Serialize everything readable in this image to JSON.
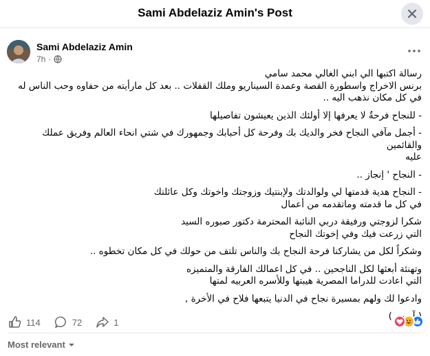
{
  "header": {
    "title": "Sami Abdelaziz Amin's Post",
    "close_icon": "close-icon"
  },
  "author": {
    "name": "Sami Abdelaziz Amin",
    "time": "7h",
    "privacy_icon": "globe-icon",
    "more_icon": "more-horizontal-icon"
  },
  "post": {
    "paragraphs": [
      "رسالة اكتبها الي ابني الغالي محمد سامي\nبرنس الاخراج واسطورة القصة وعمدة السيناريو وملك القفلات .. بعد كل مارأيته من حفاوه وحب الناس له\nفي كل مكان نذهب اليه ..",
      "- للنجاح فرحةٌ لا يعرفها إلا أولئك الذين يعيشون تفاصيلها",
      "- أجمل مآفي النجاح فخر والديك بك وفرحة كل أحبابك وجمهورك في شتي انحاء العالم وفريق عملك والقائمين\nعليه",
      "- النجاح ' إنجاز ..",
      "- النجاح هدية قدمتها لي ولوالدتك ولإبنتيك وزوجتك واخوتك وكل عائلتك\nفي كل ما قدمته وماتقدمه من أعمال",
      "شكرا لزوجتي ورفيقة دربي النائبة المحترمة دكتور صبوره السيد\nالتي زرعت فيك وفي إخوتك النجاح",
      "وشكراً لكل من يشاركنا فرحة النجاح بك والناس تلتف من حولك في كل مكان تخطوه ..",
      "وتهنئة أبعثها لكل الناجحين .. في كل اعمالك الفارقة والمتميزه\nالتي اعادت للدراما المصرية هيبتها وللأسره العربيه لمتها",
      "وادعوا لك ولهم بمسيرة نجاح في الدنيا يتبعها فلاح في الأخرة ,",
      "( آمـين )"
    ]
  },
  "stats": {
    "likes": "114",
    "comments": "72",
    "shares": "1",
    "like_icon": "like-icon",
    "comment_icon": "comment-icon",
    "share_icon": "share-icon",
    "reactions": [
      "heart-icon",
      "haha-icon",
      "like-icon"
    ],
    "colors": {
      "heart": "#f33e58",
      "haha": "#f7b125",
      "like": "#1877f2"
    }
  },
  "sort": {
    "label": "Most relevant",
    "icon": "chevron-down-icon"
  }
}
